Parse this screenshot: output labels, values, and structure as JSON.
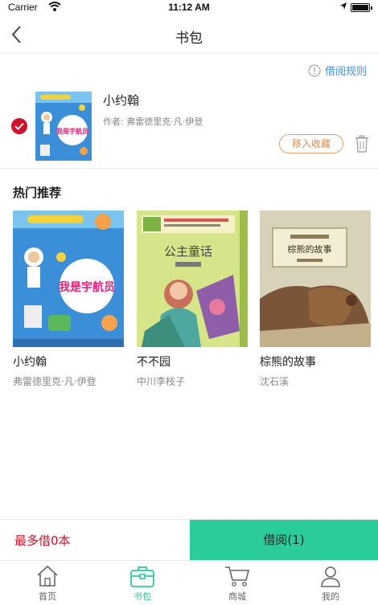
{
  "status_bar": {
    "carrier": "Carrier",
    "time": "11:12 AM"
  },
  "nav": {
    "title": "书包"
  },
  "rules_link": {
    "label": "借阅规则"
  },
  "cart_item": {
    "title": "小约翰",
    "author": "作者:  弗雷德里克·凡·伊登",
    "favorite_label": "移入收藏",
    "cover_text": "我是宇航员"
  },
  "section": {
    "title": "热门推荐"
  },
  "recommendations": [
    {
      "title": "小约翰",
      "author": "弗雷德里克·凡·伊登",
      "cover_text": "我是宇航员"
    },
    {
      "title": "不不园",
      "author": "中川李枝子",
      "cover_text": "公主童话"
    },
    {
      "title": "棕熊的故事",
      "author": "沈石溪",
      "cover_text": "棕熊的故事"
    }
  ],
  "action_bar": {
    "limit": "最多借0本",
    "borrow_label": "借阅(1)"
  },
  "tabs": [
    {
      "label": "首页"
    },
    {
      "label": "书包"
    },
    {
      "label": "商城"
    },
    {
      "label": "我的"
    }
  ],
  "colors": {
    "accent": "#2ccb9a",
    "danger": "#d0112b",
    "link": "#4a90e2",
    "favorite": "#e08a47"
  }
}
